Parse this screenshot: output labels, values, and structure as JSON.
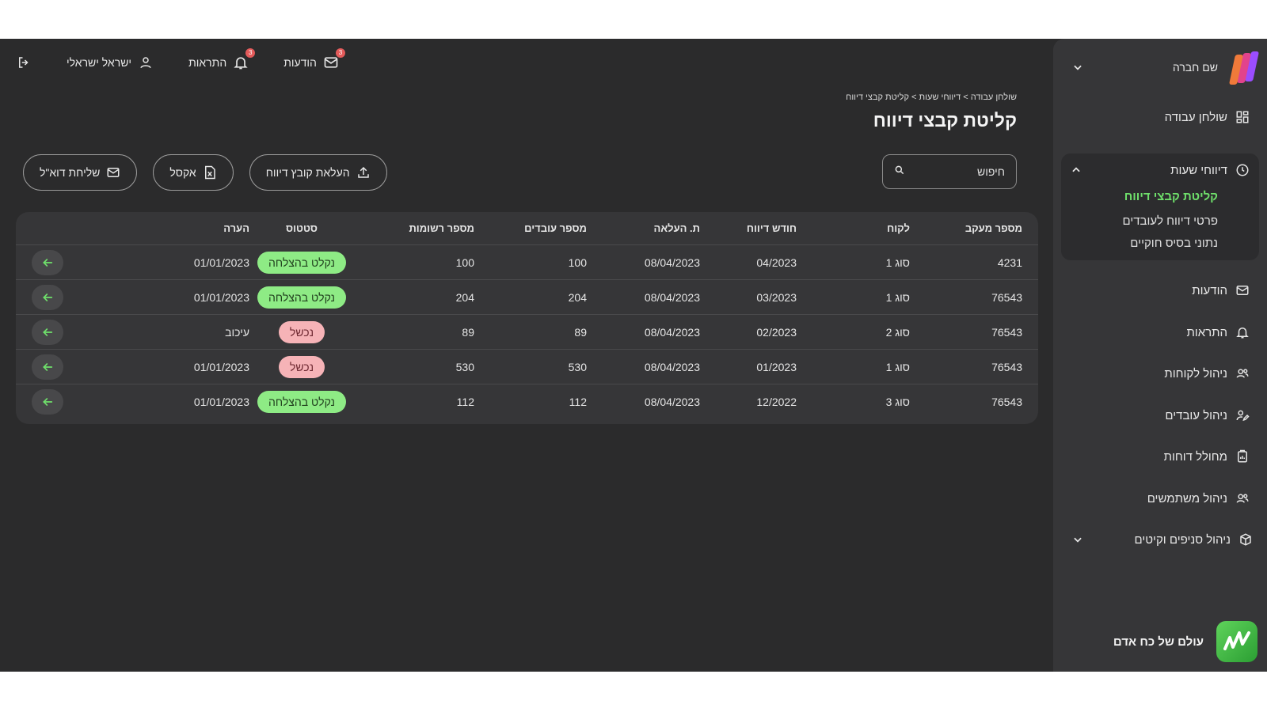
{
  "topbar": {
    "logout_icon": "logout-icon",
    "user_name": "ישראל ישראלי",
    "alerts_label": "התראות",
    "alerts_count": "3",
    "messages_label": "הודעות",
    "messages_count": "3"
  },
  "breadcrumb": "שולחן עבודה > דיווחי שעות > קליטת קבצי דיווח",
  "page_title": "קליטת קבצי דיווח",
  "search": {
    "placeholder": "חיפוש"
  },
  "actions": {
    "upload_label": "העלאת קובץ דיווח",
    "excel_label": "אקסל",
    "email_label": "שליחת דוא\"ל"
  },
  "sidebar": {
    "company_name": "שם חברה",
    "dashboard": "שולחן עבודה",
    "time_reports": "דיווחי שעות",
    "sub_items": [
      "קליטת קבצי דיווח",
      "פרטי דיווח לעובדים",
      "נתוני בסיס חוקיים"
    ],
    "messages": "הודעות",
    "alerts": "התראות",
    "clients": "ניהול לקוחות",
    "employees": "ניהול עובדים",
    "reports": "מחולל דוחות",
    "users": "ניהול משתמשים",
    "branches": "ניהול סניפים וקיטים",
    "brand_name": "עולם של כח אדם"
  },
  "table": {
    "headers": {
      "tracking": "מספר מעקב",
      "client": "לקוח",
      "month": "חודש דיווח",
      "upload_date": "ת. העלאה",
      "employees": "מספר עובדים",
      "records": "מספר רשומות",
      "status": "סטטוס",
      "note": "הערה"
    },
    "rows": [
      {
        "tracking": "4231",
        "client": "סוג 1",
        "month": "04/2023",
        "upload_date": "08/04/2023",
        "employees": "100",
        "records": "100",
        "status": "נקלט בהצלחה",
        "note": "01/01/2023"
      },
      {
        "tracking": "76543",
        "client": "סוג 1",
        "month": "03/2023",
        "upload_date": "08/04/2023",
        "employees": "204",
        "records": "204",
        "status": "נקלט בהצלחה",
        "note": "01/01/2023"
      },
      {
        "tracking": "76543",
        "client": "סוג 2",
        "month": "02/2023",
        "upload_date": "08/04/2023",
        "employees": "89",
        "records": "89",
        "status": "נכשל",
        "note": "עיכוב"
      },
      {
        "tracking": "76543",
        "client": "סוג 1",
        "month": "01/2023",
        "upload_date": "08/04/2023",
        "employees": "530",
        "records": "530",
        "status": "נכשל",
        "note": "01/01/2023"
      },
      {
        "tracking": "76543",
        "client": "סוג 3",
        "month": "12/2022",
        "upload_date": "08/04/2023",
        "employees": "112",
        "records": "112",
        "status": "נקלט בהצלחה",
        "note": "01/01/2023"
      }
    ]
  },
  "colors": {
    "accent": "#6fe06b",
    "success_pill": "#8eeb85",
    "fail_pill": "#f6b3b7",
    "badge": "#e35a5a"
  }
}
